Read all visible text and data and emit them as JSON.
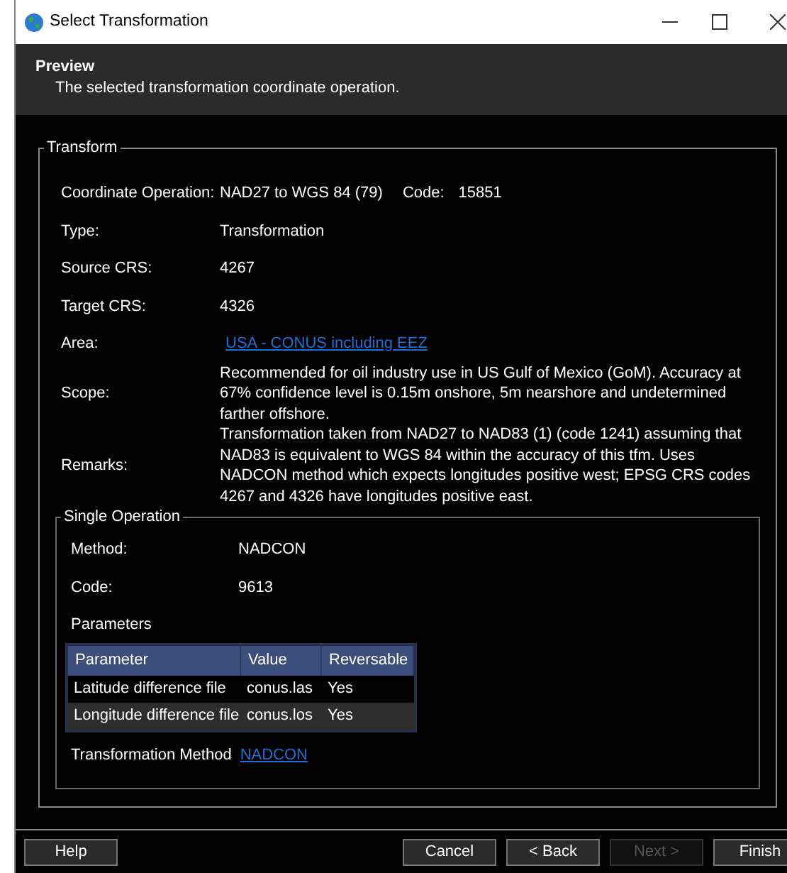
{
  "window": {
    "title": "Select Transformation"
  },
  "header": {
    "title": "Preview",
    "subtitle": "The selected transformation coordinate operation."
  },
  "transform": {
    "legend": "Transform",
    "operation": {
      "label": "Coordinate Operation:",
      "value": "NAD27 to WGS 84 (79)",
      "code_label": "Code:",
      "code_value": "15851"
    },
    "fields": [
      {
        "kind": "text",
        "label": "Type:",
        "value": "Transformation"
      },
      {
        "kind": "text",
        "label": "Source CRS:",
        "value": "4267"
      },
      {
        "kind": "text",
        "label": "Target CRS:",
        "value": "4326"
      },
      {
        "kind": "link",
        "label": "Area:",
        "value": "USA - CONUS including EEZ"
      },
      {
        "kind": "text",
        "label": "Scope:",
        "value": "Recommended for oil industry use in US Gulf of Mexico (GoM). Accuracy at 67% confidence level is 0.15m onshore, 5m nearshore and undetermined farther offshore."
      },
      {
        "kind": "text",
        "label": "Remarks:",
        "value": "Transformation taken from NAD27 to NAD83 (1) (code 1241) assuming that NAD83 is equivalent to WGS 84 within the accuracy of this tfm. Uses NADCON method which expects longitudes positive west; EPSG CRS codes 4267 and 4326 have longitudes positive east."
      }
    ],
    "single_operation": {
      "legend": "Single Operation",
      "fields": [
        {
          "label": "Method:",
          "value": "NADCON"
        },
        {
          "label": "Code:",
          "value": "9613"
        }
      ],
      "parameters_label": "Parameters",
      "table": {
        "columns": [
          "Parameter",
          "Value",
          "Reversable"
        ],
        "rows": [
          {
            "cells": [
              "Latitude difference file",
              "conus.las",
              "Yes"
            ],
            "selected": false
          },
          {
            "cells": [
              "Longitude difference file",
              "conus.los",
              "Yes"
            ],
            "selected": true
          }
        ]
      },
      "method_link": {
        "label": "Transformation Method",
        "link": "NADCON"
      }
    }
  },
  "buttons": [
    {
      "label": "Help",
      "disabled": false
    },
    {
      "label": "Cancel",
      "disabled": false
    },
    {
      "label": "< Back",
      "disabled": false
    },
    {
      "label": "Next >",
      "disabled": true
    },
    {
      "label": "Finish",
      "disabled": false
    }
  ]
}
